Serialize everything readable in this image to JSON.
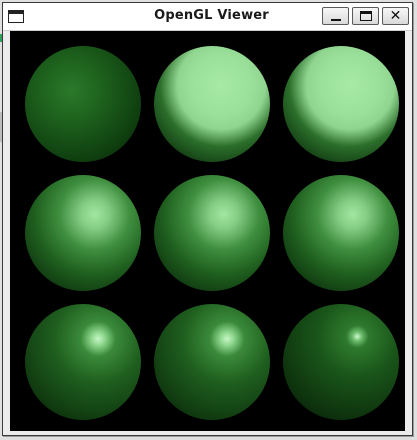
{
  "window": {
    "title": "OpenGL Viewer",
    "controls": {
      "minimize_icon": "minimize-icon",
      "maximize_icon": "maximize-icon",
      "close_icon": "close-icon",
      "close_glyph": "✕"
    }
  },
  "scene": {
    "background_color": "#000000",
    "material_color": "#1f6b1f",
    "highlight_color": "#a8e8a8",
    "spheres": [
      {
        "row": 1,
        "col": 1,
        "highlight": "none"
      },
      {
        "row": 1,
        "col": 2,
        "highlight": "large"
      },
      {
        "row": 1,
        "col": 3,
        "highlight": "large"
      },
      {
        "row": 2,
        "col": 1,
        "highlight": "medium"
      },
      {
        "row": 2,
        "col": 2,
        "highlight": "medium"
      },
      {
        "row": 2,
        "col": 3,
        "highlight": "medium"
      },
      {
        "row": 3,
        "col": 1,
        "highlight": "small"
      },
      {
        "row": 3,
        "col": 2,
        "highlight": "small"
      },
      {
        "row": 3,
        "col": 3,
        "highlight": "tiny"
      }
    ]
  }
}
